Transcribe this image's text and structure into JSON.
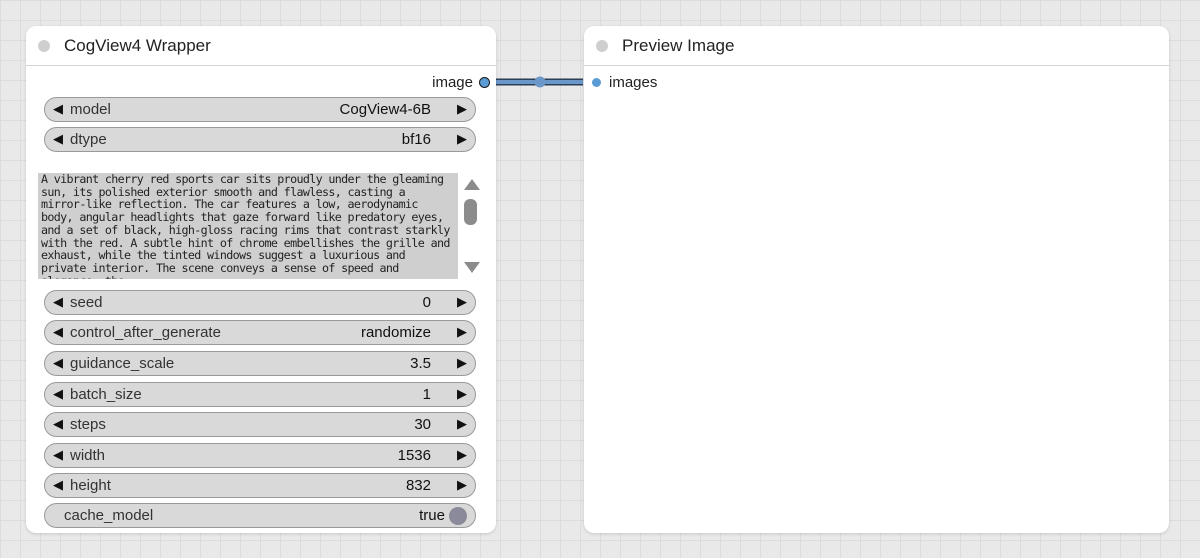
{
  "wrapper_node": {
    "title": "CogView4 Wrapper",
    "output_label": "image",
    "widgets": {
      "model": {
        "label": "model",
        "value": "CogView4-6B"
      },
      "dtype": {
        "label": "dtype",
        "value": "bf16"
      },
      "seed": {
        "label": "seed",
        "value": "0"
      },
      "control_after_generate": {
        "label": "control_after_generate",
        "value": "randomize"
      },
      "guidance_scale": {
        "label": "guidance_scale",
        "value": "3.5"
      },
      "batch_size": {
        "label": "batch_size",
        "value": "1"
      },
      "steps": {
        "label": "steps",
        "value": "30"
      },
      "width": {
        "label": "width",
        "value": "1536"
      },
      "height": {
        "label": "height",
        "value": "832"
      },
      "cache_model": {
        "label": "cache_model",
        "value": "true"
      }
    },
    "prompt_text": "A vibrant cherry red sports car sits proudly under the gleaming sun, its polished exterior smooth and flawless, casting a mirror-like reflection. The car features a low, aerodynamic body, angular headlights that gaze forward like predatory eyes, and a set of black, high-gloss racing rims that contrast starkly with the red. A subtle hint of chrome embellishes the grille and exhaust, while the tinted windows suggest a luxurious and private interior. The scene conveys a sense of speed and elegance, the"
  },
  "preview_node": {
    "title": "Preview Image",
    "input_label": "images"
  },
  "colors": {
    "link": "#5b86b6",
    "port": "#5b9bd5"
  }
}
